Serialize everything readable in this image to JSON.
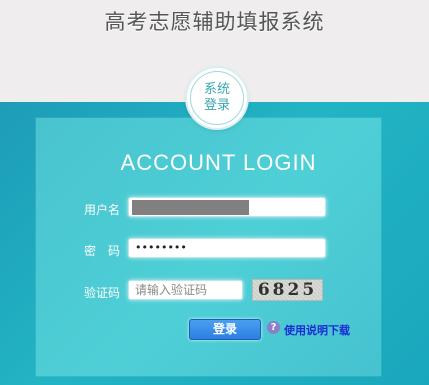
{
  "header": {
    "title": "高考志愿辅助填报系统"
  },
  "badge": {
    "line1": "系统",
    "line2": "登录"
  },
  "login": {
    "heading": "ACCOUNT LOGIN",
    "username_label": "用户名",
    "username_value": "",
    "password_label": "密　码",
    "password_value": "••••••••",
    "captcha_label": "验证码",
    "captcha_placeholder": "请输入验证码",
    "captcha_code": "6825",
    "submit_label": "登录",
    "help_icon_glyph": "?",
    "help_link": "使用说明下载"
  },
  "colors": {
    "accent": "#2d7fe0",
    "panel": "#4ecfd6",
    "band": "#1d9cb8",
    "link": "#1a2bd6"
  },
  "icons": {
    "help": "question-circle-icon"
  }
}
